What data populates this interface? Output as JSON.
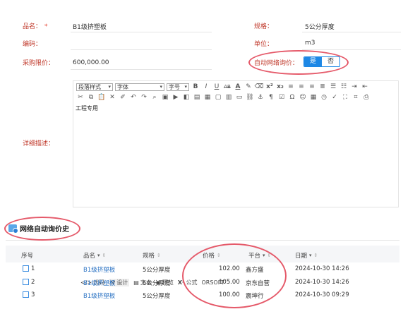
{
  "form": {
    "name_label": "品名：",
    "name_required": "*",
    "name_value": "B1级挤塑板",
    "spec_label": "规格：",
    "spec_value": "5公分厚度",
    "code_label": "编码：",
    "code_value": "",
    "unit_label": "单位：",
    "unit_value": "m3",
    "limit_price_label": "采购限价：",
    "limit_price_value": "600,000.00",
    "auto_inquiry_label": "自动网络询价：",
    "toggle_yes": "是",
    "toggle_no": "否",
    "toggle_selected": "是",
    "detail_label": "详细描述："
  },
  "editor": {
    "paragraph_format": "段落样式",
    "font": "字体",
    "font_size": "字号",
    "content": "工程专用",
    "footer": {
      "code": "代码",
      "design": "设计",
      "text": "文本",
      "preview": "预览",
      "formula": "公式",
      "orsoft": "ORSOFT"
    }
  },
  "history": {
    "title": "网络自动询价史",
    "columns": {
      "index": "序号",
      "name": "品名",
      "spec": "规格",
      "price": "价格",
      "platform": "平台",
      "date": "日期"
    },
    "rows": [
      {
        "index": "1",
        "name": "B1级挤塑板",
        "spec": "5公分厚度",
        "price": "102.00",
        "platform": "鑫方盛",
        "date": "2024-10-30 14:26"
      },
      {
        "index": "2",
        "name": "B1级挤塑板",
        "spec": "5公分厚度",
        "price": "105.00",
        "platform": "京东自营",
        "date": "2024-10-30 14:26"
      },
      {
        "index": "3",
        "name": "B1级挤塑板",
        "spec": "5公分厚度",
        "price": "100.00",
        "platform": "震坤行",
        "date": "2024-10-30 09:29"
      }
    ]
  },
  "colors": {
    "accent": "#1e88e5",
    "label_red": "#c0392b",
    "annotation_ring": "#e55a6a",
    "link": "#2d74c4"
  }
}
